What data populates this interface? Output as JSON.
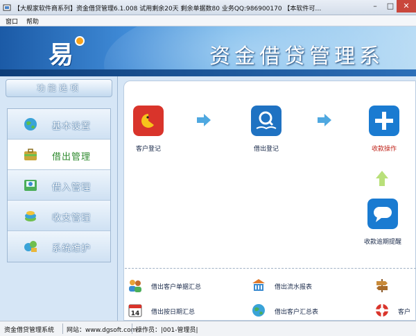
{
  "window": {
    "title": "【大舰家软件商系列】资金借贷管理6.1.008      试用剩余20天  剩余单据数80      业务QQ:986900170    【本软件可…",
    "min_glyph": "–",
    "max_glyph": "□",
    "close_glyph": "✕"
  },
  "menu": [
    "窗口",
    "帮助"
  ],
  "banner": {
    "logo_text": "易",
    "title": "资金借贷管理系"
  },
  "sidebar": {
    "header": "功能选项",
    "items": [
      {
        "label": "基本设置",
        "icon": "globe-settings-icon",
        "active": false
      },
      {
        "label": "借出管理",
        "icon": "briefcase-icon",
        "active": true
      },
      {
        "label": "借入管理",
        "icon": "inbox-icon",
        "active": false
      },
      {
        "label": "收支管理",
        "icon": "coins-icon",
        "active": false
      },
      {
        "label": "系统维护",
        "icon": "tools-icon",
        "active": false
      }
    ]
  },
  "flow": {
    "items": [
      {
        "label": "客户登记",
        "icon": "pacman-icon",
        "color": "#d9342b",
        "red": false
      },
      {
        "label": "借出登记",
        "icon": "magnifier-book-icon",
        "color": "#1f72c2",
        "red": false
      },
      {
        "label": "收款操作",
        "icon": "plus-icon",
        "color": "#1a7bd1",
        "red": true
      },
      {
        "label": "收款逾期提醒",
        "icon": "chat-bubble-icon",
        "color": "#1a7bd1",
        "red": false
      }
    ]
  },
  "reports": [
    {
      "label": "借出客户单据汇总",
      "icon": "people-icon"
    },
    {
      "label": "借出流水报表",
      "icon": "bank-icon"
    },
    {
      "label": "",
      "icon": "signpost-icon"
    },
    {
      "label": "借出按日期汇总",
      "icon": "calendar-14-icon",
      "cal_day": "14"
    },
    {
      "label": "借出客户汇总表",
      "icon": "globe-icon"
    },
    {
      "label": "客户",
      "icon": "lifebuoy-icon"
    }
  ],
  "status": {
    "app": "资金借贷管理系统",
    "website_label": "网站：www.dgsoft.com",
    "operator": "操作员：|001-管理员|"
  },
  "colors": {
    "banner_dark": "#1b5aa6",
    "sidebar_bg": "#d6e6f6",
    "active_label": "#2e8a2e",
    "alert_red": "#c0261c"
  }
}
